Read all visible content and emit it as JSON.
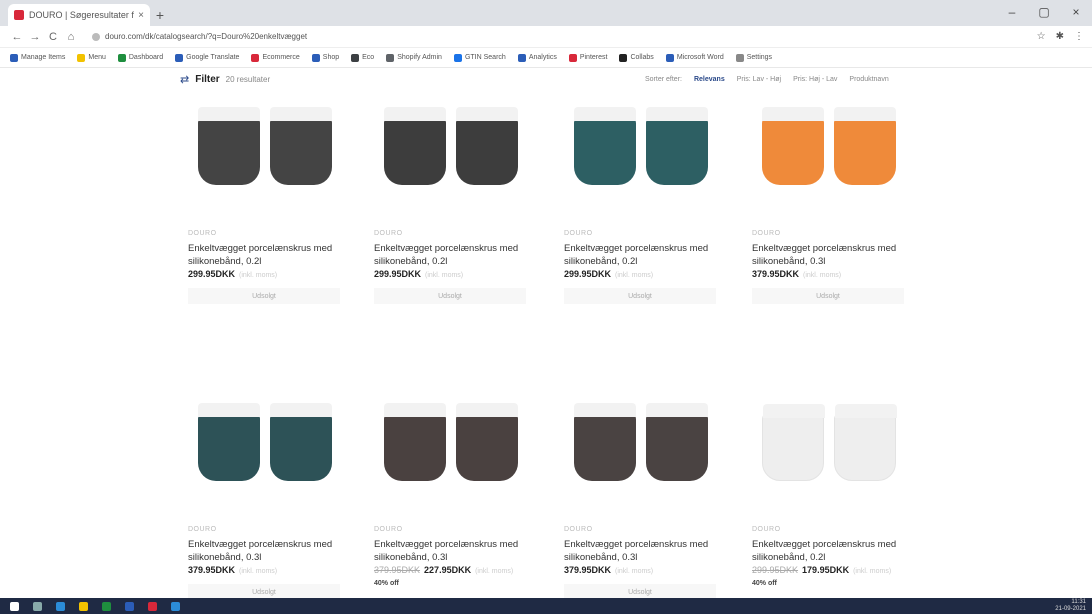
{
  "browser": {
    "tab_title": "DOURO | Søgeresultater for",
    "tab_close": "×",
    "new_tab": "+",
    "win_min": "–",
    "win_max": "▢",
    "win_close": "×",
    "back": "←",
    "forward": "→",
    "reload": "C",
    "home": "⌂",
    "url": "douro.com/dk/catalogsearch/?q=Douro%20enkeltvægget",
    "ext_star": "☆",
    "ext_puzzle": "✱",
    "ext_menu": "⋮",
    "bookmarks": [
      {
        "label": "Manage Items",
        "color": "#2b5db8"
      },
      {
        "label": "Menu",
        "color": "#f2c200"
      },
      {
        "label": "Dashboard",
        "color": "#1e8e3e"
      },
      {
        "label": "Google Translate",
        "color": "#2b5db8"
      },
      {
        "label": "Ecommerce",
        "color": "#d8283a"
      },
      {
        "label": "Shop",
        "color": "#2b5db8"
      },
      {
        "label": "Eco",
        "color": "#3c4043"
      },
      {
        "label": "Shopify Admin",
        "color": "#5f6368"
      },
      {
        "label": "GTIN Search",
        "color": "#1a73e8"
      },
      {
        "label": "Analytics",
        "color": "#2b5db8"
      },
      {
        "label": "Pinterest",
        "color": "#d8283a"
      },
      {
        "label": "Collabs",
        "color": "#222"
      },
      {
        "label": "Microsoft Word",
        "color": "#2b5db8"
      },
      {
        "label": "Settings",
        "color": "#888"
      }
    ]
  },
  "filter": {
    "icon": "⇄",
    "label": "Filter",
    "results": "20 resultater",
    "sort": [
      {
        "label": "Sorter efter:",
        "active": false
      },
      {
        "label": "Relevans",
        "active": true
      },
      {
        "label": "Pris: Lav - Høj",
        "active": false
      },
      {
        "label": "Pris: Høj - Lav",
        "active": false
      },
      {
        "label": "Produktnavn",
        "active": false
      }
    ]
  },
  "products": [
    {
      "brand": "DOURO",
      "name": "Enkeltvægget porcelænskrus med silikonebånd, 0.2l",
      "old_price": "",
      "price": "299.95DKK",
      "vat": "(inkl. moms)",
      "discount": "",
      "sold": "Udsolgt",
      "color": "#444444"
    },
    {
      "brand": "DOURO",
      "name": "Enkeltvægget porcelænskrus med silikonebånd, 0.2l",
      "old_price": "",
      "price": "299.95DKK",
      "vat": "(inkl. moms)",
      "discount": "",
      "sold": "Udsolgt",
      "color": "#3d3d3d"
    },
    {
      "brand": "DOURO",
      "name": "Enkeltvægget porcelænskrus med silikonebånd, 0.2l",
      "old_price": "",
      "price": "299.95DKK",
      "vat": "(inkl. moms)",
      "discount": "",
      "sold": "Udsolgt",
      "color": "#2d5f63"
    },
    {
      "brand": "DOURO",
      "name": "Enkeltvægget porcelænskrus med silikonebånd, 0.3l",
      "old_price": "",
      "price": "379.95DKK",
      "vat": "(inkl. moms)",
      "discount": "",
      "sold": "Udsolgt",
      "color": "#ef8a3a"
    },
    {
      "brand": "DOURO",
      "name": "Enkeltvægget porcelænskrus med silikonebånd, 0.3l",
      "old_price": "",
      "price": "379.95DKK",
      "vat": "(inkl. moms)",
      "discount": "",
      "sold": "Udsolgt",
      "color": "#2d5257"
    },
    {
      "brand": "DOURO",
      "name": "Enkeltvægget porcelænskrus med silikonebånd, 0.3l",
      "old_price": "379.95DKK",
      "price": "227.95DKK",
      "vat": "(inkl. moms)",
      "discount": "40% off",
      "sold": "",
      "color": "#4a4140"
    },
    {
      "brand": "DOURO",
      "name": "Enkeltvægget porcelænskrus med silikonebånd, 0.3l",
      "old_price": "",
      "price": "379.95DKK",
      "vat": "(inkl. moms)",
      "discount": "",
      "sold": "Udsolgt",
      "color": "#4a4342"
    },
    {
      "brand": "DOURO",
      "name": "Enkeltvægget porcelænskrus med silikonebånd, 0.2l",
      "old_price": "299.95DKK",
      "price": "179.95DKK",
      "vat": "(inkl. moms)",
      "discount": "40% off",
      "sold": "",
      "color": "#eeeeee"
    }
  ],
  "taskbar": {
    "clock_time": "11:31",
    "clock_date": "21-09-2021"
  }
}
